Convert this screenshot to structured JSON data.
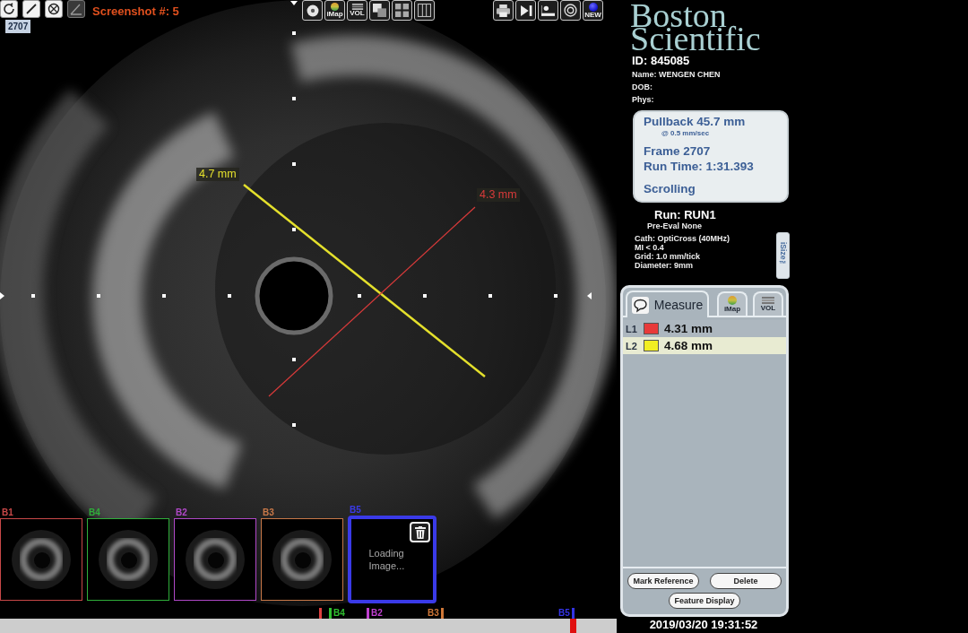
{
  "top_left_tools": [
    {
      "kind": "trace",
      "disabled": false
    },
    {
      "kind": "line",
      "disabled": false
    },
    {
      "kind": "circle",
      "disabled": false
    },
    {
      "kind": "angle",
      "disabled": true
    }
  ],
  "screenshot_counter": "Screenshot #: 5",
  "frame_badge": "2707",
  "view_toolbar": [
    {
      "kind": "disc"
    },
    {
      "kind": "ball",
      "label": "iMap"
    },
    {
      "kind": "stripes",
      "label": "VOL"
    },
    {
      "kind": "squares"
    },
    {
      "kind": "grid"
    },
    {
      "kind": "columns"
    }
  ],
  "action_toolbar": [
    {
      "kind": "printer"
    },
    {
      "kind": "skip"
    },
    {
      "kind": "screen"
    },
    {
      "kind": "ring"
    },
    {
      "kind": "blue",
      "label": "NEW"
    }
  ],
  "image": {
    "measurements": [
      {
        "label": "4.7 mm",
        "color": "#e4e02c"
      },
      {
        "label": "4.3 mm",
        "color": "#d83a3a"
      }
    ]
  },
  "bookmarks": [
    {
      "label": "B1",
      "color": "#c84848",
      "kind": "image",
      "selected": false
    },
    {
      "label": "B4",
      "color": "#2fae3a",
      "kind": "image",
      "selected": false
    },
    {
      "label": "B2",
      "color": "#b048c8",
      "kind": "image",
      "selected": false
    },
    {
      "label": "B3",
      "color": "#c87848",
      "kind": "image",
      "selected": false
    },
    {
      "label": "B5",
      "color": "#3a3ae8",
      "kind": "loading",
      "text": "Loading Image...",
      "selected": true
    }
  ],
  "timeline": {
    "level": 0.925,
    "markers": [
      {
        "color": "#e04040"
      },
      {
        "label": "B4",
        "color": "#30c030"
      },
      {
        "label": "B2",
        "color": "#c040d0"
      },
      {
        "label": "B3",
        "color": "#d07838"
      },
      {
        "label": "B5",
        "color": "#3434e6"
      }
    ]
  },
  "logo": "Boston Scientific",
  "patient": {
    "id": "ID: 845085",
    "fields": [
      "Name: WENGEN CHEN",
      "DOB:",
      "Phys:"
    ]
  },
  "pullback": {
    "distance": "Pullback 45.7 mm",
    "speed": "@ 0.5 mm/sec",
    "frame": "Frame 2707",
    "run_time": "Run Time: 1:31.393",
    "status": "Scrolling"
  },
  "run": {
    "title": "Run: RUN1",
    "pre_eval": "Pre-Eval None",
    "details": [
      "Cath: OptiCross (40MHz)",
      "MI < 0.4",
      "Grid: 1.0 mm/tick",
      "Diameter: 9mm"
    ],
    "side_tab": "iSize™"
  },
  "measure_panel": {
    "tabs": [
      {
        "kind": "bubble",
        "label": "Measure",
        "selected": true
      },
      {
        "kind": "ball",
        "label": "iMap",
        "selected": false
      },
      {
        "kind": "stripes",
        "label": "VOL",
        "selected": false
      }
    ],
    "rows": [
      {
        "name": "L1",
        "color": "#e83a3a",
        "value": "4.31 mm",
        "selected": false
      },
      {
        "name": "L2",
        "color": "#f2ee22",
        "value": "4.68 mm",
        "selected": true
      }
    ],
    "buttons": [
      "Mark Reference",
      "Delete",
      "Feature Display"
    ]
  },
  "timestamp": "2019/03/20 19:31:52"
}
